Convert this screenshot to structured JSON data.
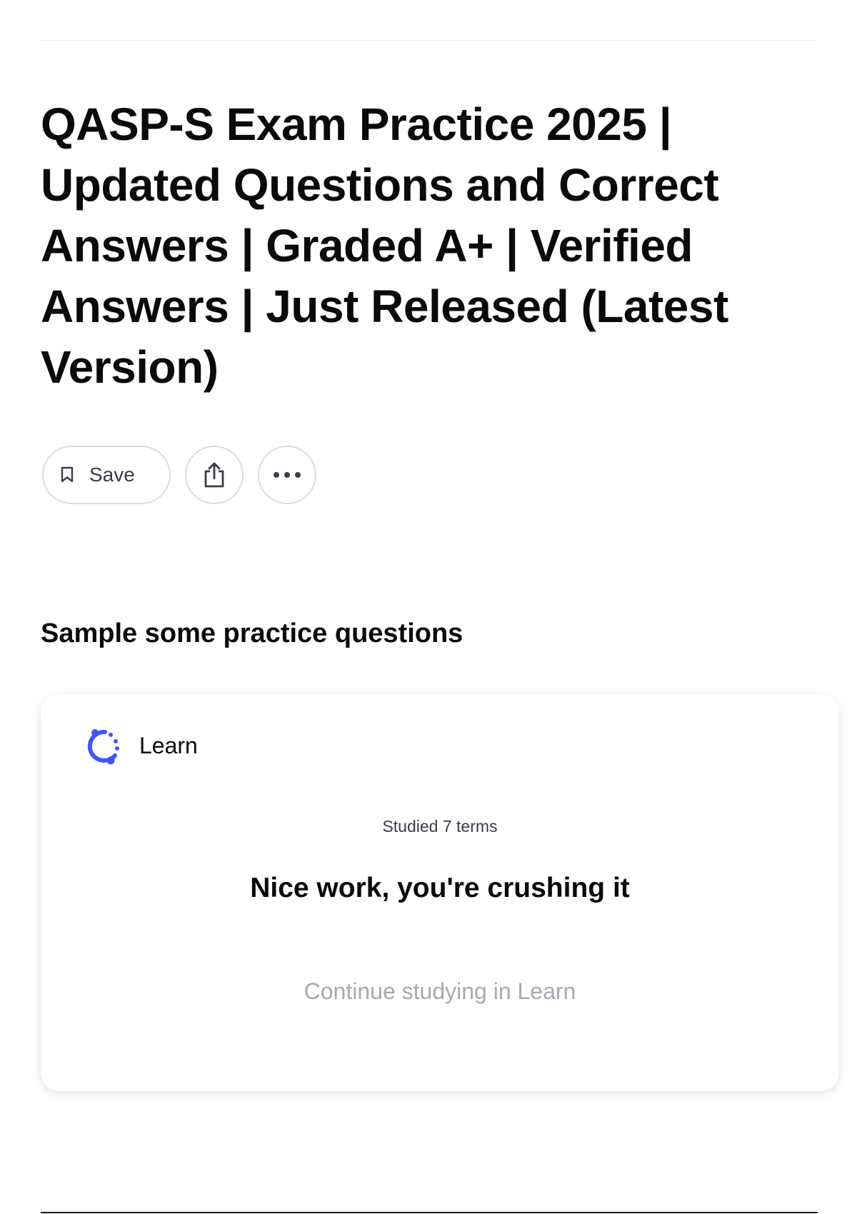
{
  "title": "QASP-S Exam Practice 2025 | Updated Questions and Correct Answers | Graded A+ | Verified Answers | Just Released (Latest Version)",
  "actions": {
    "save_label": "Save",
    "save_icon": "bookmark-icon",
    "share_icon": "share-icon",
    "more_icon": "more-horizontal-icon"
  },
  "practice": {
    "heading": "Sample some practice questions",
    "card": {
      "mode_label": "Learn",
      "mode_icon": "learn-progress-icon",
      "accent_color": "#4255ff",
      "studied_text": "Studied 7 terms",
      "message": "Nice work, you're crushing it",
      "continue_label": "Continue studying in Learn"
    }
  }
}
